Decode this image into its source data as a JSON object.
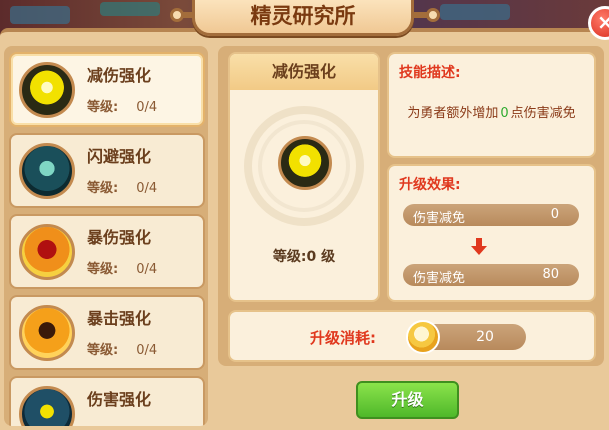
{
  "title": "精灵研究所",
  "close_label": "×",
  "skills": [
    {
      "name": "减伤强化",
      "level_label": "等级:",
      "level_value": "0/4",
      "icon": "damage-reduction-icon",
      "color": "#f2e100"
    },
    {
      "name": "闪避强化",
      "level_label": "等级:",
      "level_value": "0/4",
      "icon": "dodge-icon",
      "color": "#1a4f5a"
    },
    {
      "name": "暴伤强化",
      "level_label": "等级:",
      "level_value": "0/4",
      "icon": "crit-damage-icon",
      "color": "#f08f1a"
    },
    {
      "name": "暴击强化",
      "level_label": "等级:",
      "level_value": "0/4",
      "icon": "crit-icon",
      "color": "#f5a01a"
    },
    {
      "name": "伤害强化",
      "level_label": "",
      "level_value": "",
      "icon": "damage-icon",
      "color": "#1f4f66"
    }
  ],
  "detail": {
    "name": "减伤强化",
    "level_text": "等级:0 级"
  },
  "description": {
    "title": "技能描述:",
    "prefix": "为勇者额外增加",
    "value": "0",
    "suffix": "点伤害减免"
  },
  "effect": {
    "title": "升级效果:",
    "current_label": "伤害减免",
    "current_value": "0",
    "next_label": "伤害减免",
    "next_value": "80"
  },
  "cost": {
    "label": "升级消耗:",
    "value": "20",
    "icon": "gold-coin-icon"
  },
  "upgrade_button": "升级",
  "colors": {
    "accent_red": "#e0381e",
    "green": "#2eaa2e",
    "button_green": "#4fb82a"
  }
}
